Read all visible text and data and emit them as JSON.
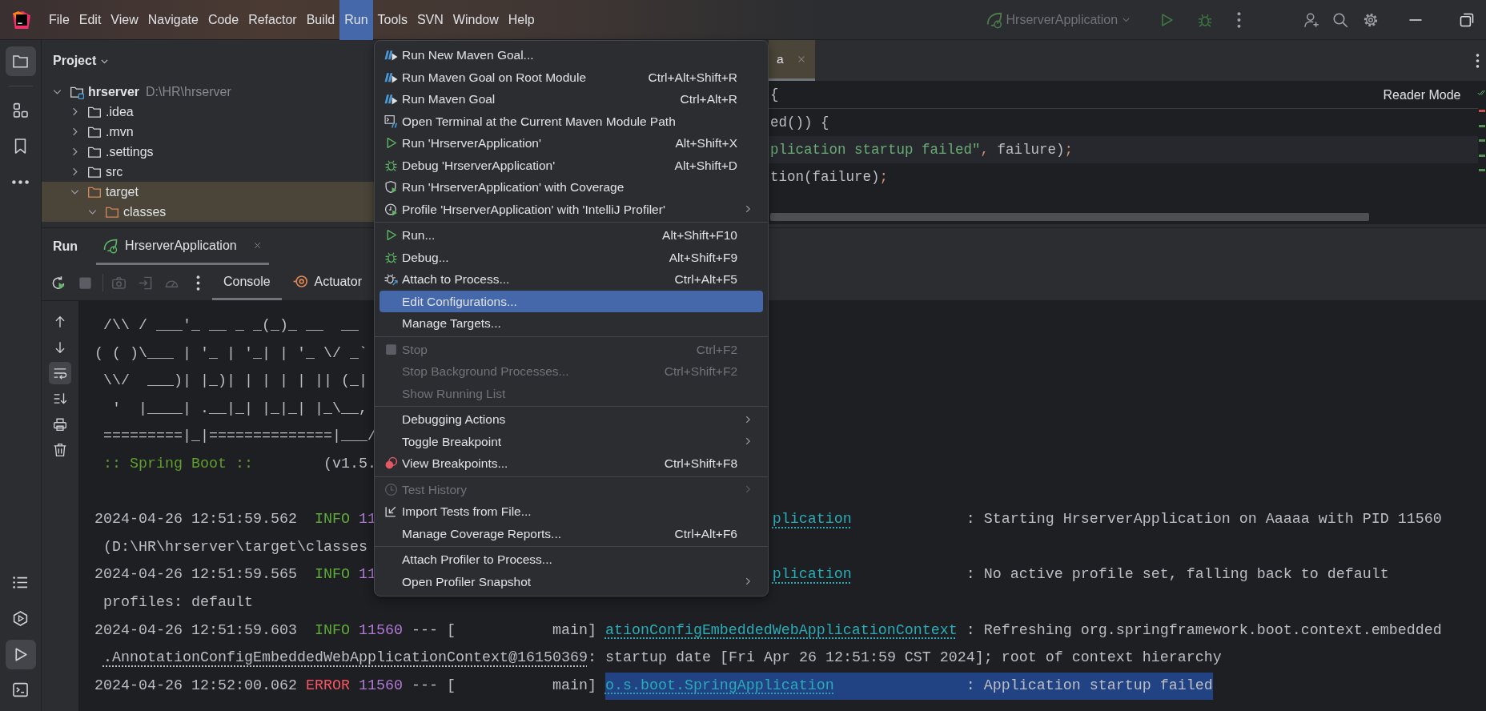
{
  "title_bar": {
    "menus": [
      {
        "label": "File",
        "selected": false
      },
      {
        "label": "Edit",
        "selected": false
      },
      {
        "label": "View",
        "selected": false
      },
      {
        "label": "Navigate",
        "selected": false
      },
      {
        "label": "Code",
        "selected": false
      },
      {
        "label": "Refactor",
        "selected": false
      },
      {
        "label": "Build",
        "selected": false
      },
      {
        "label": "Run",
        "selected": true
      },
      {
        "label": "Tools",
        "selected": false
      },
      {
        "label": "SVN",
        "selected": false
      },
      {
        "label": "Window",
        "selected": false
      },
      {
        "label": "Help",
        "selected": false
      }
    ],
    "run_config": "HrserverApplication"
  },
  "tool_strip": {
    "top": [
      {
        "kind": "project",
        "selected": true
      },
      {
        "kind": "structure",
        "selected": false
      },
      {
        "kind": "bookmarks",
        "selected": false
      },
      {
        "kind": "more",
        "selected": false
      }
    ],
    "bottom": [
      {
        "kind": "list",
        "selected": false
      },
      {
        "kind": "services",
        "selected": false
      },
      {
        "kind": "run",
        "selected": true
      },
      {
        "kind": "terminal",
        "selected": false
      }
    ]
  },
  "project": {
    "title": "Project",
    "tree": [
      {
        "name": "hrserver",
        "path": "D:\\HR\\hrserver",
        "module": true,
        "expanded": true,
        "excluded": false,
        "children": [
          {
            "name": ".idea",
            "expanded": false,
            "excluded": false
          },
          {
            "name": ".mvn",
            "expanded": false,
            "excluded": false
          },
          {
            "name": ".settings",
            "expanded": false,
            "excluded": false
          },
          {
            "name": "src",
            "expanded": false,
            "excluded": false
          },
          {
            "name": "target",
            "expanded": true,
            "excluded": true,
            "children": [
              {
                "name": "classes",
                "expanded": true,
                "excluded": true
              }
            ]
          }
        ]
      }
    ]
  },
  "editor": {
    "tabs": [
      {
        "label": "a",
        "selected": true
      }
    ],
    "reader_mode": "Reader Mode",
    "sticky_line": [
      {
        "kind": "plain",
        "text": "{"
      }
    ],
    "lines": [
      {
        "highlighted": false,
        "segments": [
          {
            "kind": "plain",
            "text": "ed()) {"
          }
        ]
      },
      {
        "highlighted": true,
        "segments": [
          {
            "kind": "string",
            "text": "plication startup failed\""
          },
          {
            "kind": "keyword",
            "text": ","
          },
          {
            "kind": "plain",
            "text": " failure)"
          },
          {
            "kind": "keyword",
            "text": ";"
          }
        ]
      },
      {
        "highlighted": false,
        "segments": [
          {
            "kind": "plain",
            "text": "tion(failure)"
          },
          {
            "kind": "keyword",
            "text": ";"
          }
        ]
      }
    ],
    "change_marks": [
      {
        "color": "#c75450"
      },
      {
        "color": "#549159"
      },
      {
        "color": "#549159"
      },
      {
        "color": "#549159"
      },
      {
        "color": "#549159"
      }
    ]
  },
  "run_window": {
    "title": "Run",
    "tabs": [
      {
        "label": "HrserverApplication",
        "selected": true
      }
    ],
    "toolbar": [
      {
        "kind": "rerun",
        "disabled": false
      },
      {
        "kind": "stop",
        "disabled": true
      },
      {
        "kind": "screenshot",
        "disabled": true
      },
      {
        "kind": "exit",
        "disabled": true
      },
      {
        "kind": "gauge",
        "disabled": true
      },
      {
        "kind": "more",
        "disabled": false
      }
    ],
    "views": [
      {
        "label": "Console",
        "kind": "console",
        "selected": true
      },
      {
        "label": "Actuator",
        "kind": "actuator",
        "selected": false
      }
    ],
    "console_tools": [
      {
        "kind": "up",
        "selected": false
      },
      {
        "kind": "down",
        "selected": false
      },
      {
        "kind": "wrap",
        "selected": true
      },
      {
        "kind": "scroll-end",
        "selected": false
      },
      {
        "kind": "print",
        "selected": false
      },
      {
        "kind": "trash",
        "selected": false
      }
    ],
    "console": [
      {
        "kind": "banner",
        "highlighted": false,
        "segments": [
          {
            "kind": "plain",
            "text": " /\\\\ / ___'_ __ _ _(_)_ __  __"
          }
        ]
      },
      {
        "kind": "banner",
        "highlighted": false,
        "segments": [
          {
            "kind": "plain",
            "text": "( ( )\\___ | '_ | '_| | '_ \\/ _`"
          }
        ]
      },
      {
        "kind": "banner",
        "highlighted": false,
        "segments": [
          {
            "kind": "plain",
            "text": " \\\\/  ___)| |_)| | | | | || (_|"
          }
        ]
      },
      {
        "kind": "banner",
        "highlighted": false,
        "segments": [
          {
            "kind": "plain",
            "text": "  '  |____| .__|_| |_|_| |_\\__,"
          }
        ]
      },
      {
        "kind": "banner",
        "highlighted": false,
        "segments": [
          {
            "kind": "plain",
            "text": " =========|_|==============|___/"
          }
        ]
      },
      {
        "kind": "banner",
        "highlighted": false,
        "segments": [
          {
            "kind": "green",
            "text": " :: Spring Boot ::"
          },
          {
            "kind": "plain",
            "text": "        (v1.5."
          }
        ]
      },
      {
        "kind": "blank",
        "highlighted": false
      },
      {
        "kind": "log",
        "highlighted": false,
        "segments": [
          {
            "kind": "time",
            "text": "2024-04-26 12:51:59.562"
          },
          {
            "kind": "info",
            "text": "INFO"
          },
          {
            "kind": "pid",
            "text": "11"
          }
        ],
        "right": [
          {
            "kind": "logger",
            "text": "plication"
          },
          {
            "kind": "plain",
            "text": ": Starting HrserverApplication on Aaaaa with PID 11560"
          }
        ]
      },
      {
        "kind": "wrap",
        "highlighted": false,
        "segments": [
          {
            "kind": "plain",
            "text": "(D:\\HR\\hrserver\\target\\classes"
          }
        ]
      },
      {
        "kind": "log",
        "highlighted": false,
        "segments": [
          {
            "kind": "time",
            "text": "2024-04-26 12:51:59.565"
          },
          {
            "kind": "info",
            "text": "INFO"
          },
          {
            "kind": "pid",
            "text": "11"
          }
        ],
        "right": [
          {
            "kind": "logger",
            "text": "plication"
          },
          {
            "kind": "plain",
            "text": ": No active profile set, falling back to default"
          }
        ]
      },
      {
        "kind": "wrap",
        "highlighted": false,
        "segments": [
          {
            "kind": "plain",
            "text": "profiles: default"
          }
        ]
      },
      {
        "kind": "log",
        "highlighted": false,
        "segments": [
          {
            "kind": "time",
            "text": "2024-04-26 12:51:59.603"
          },
          {
            "kind": "info",
            "text": "INFO"
          },
          {
            "kind": "pid",
            "text": "11560"
          },
          {
            "kind": "thread",
            "text": "--- [           main]"
          },
          {
            "kind": "logger",
            "text": "ationConfigEmbeddedWebApplicationContext"
          },
          {
            "kind": "plain",
            "text": ": Refreshing org.springframework.boot.context.embedded"
          }
        ]
      },
      {
        "kind": "wrap",
        "highlighted": false,
        "segments": [
          {
            "kind": "link",
            "text": ".AnnotationConfigEmbeddedWebApplicationContext@16150369"
          },
          {
            "kind": "plain",
            "text": ": startup date [Fri Apr 26 12:51:59 CST 2024]; root of context hierarchy"
          }
        ]
      },
      {
        "kind": "log",
        "highlighted": true,
        "segments": [
          {
            "kind": "time",
            "text": "2024-04-26 12:52:00.062"
          },
          {
            "kind": "error",
            "text": "ERROR"
          },
          {
            "kind": "pid",
            "text": "11560"
          },
          {
            "kind": "thread",
            "text": "--- [           main]"
          },
          {
            "kind": "logger",
            "text": "o.s.boot.SpringApplication"
          },
          {
            "kind": "plain",
            "text": ": Application startup failed"
          }
        ]
      }
    ]
  },
  "run_menu": {
    "groups": [
      {
        "items": [
          {
            "kind": "maven",
            "label": "Run New Maven Goal...",
            "selected": false,
            "disabled": false,
            "submenu": false
          },
          {
            "kind": "maven",
            "label": "Run Maven Goal on Root Module",
            "shortcut": "Ctrl+Alt+Shift+R",
            "selected": false,
            "disabled": false,
            "submenu": false
          },
          {
            "kind": "maven",
            "label": "Run Maven Goal",
            "shortcut": "Ctrl+Alt+R",
            "selected": false,
            "disabled": false,
            "submenu": false
          },
          {
            "kind": "terminal",
            "label": "Open Terminal at the Current Maven Module Path",
            "selected": false,
            "disabled": false,
            "submenu": false
          },
          {
            "kind": "run",
            "label": "Run 'HrserverApplication'",
            "shortcut": "Alt+Shift+X",
            "selected": false,
            "disabled": false,
            "submenu": false
          },
          {
            "kind": "debug",
            "label": "Debug 'HrserverApplication'",
            "shortcut": "Alt+Shift+D",
            "selected": false,
            "disabled": false,
            "submenu": false
          },
          {
            "kind": "coverage",
            "label": "Run 'HrserverApplication' with Coverage",
            "selected": false,
            "disabled": false,
            "submenu": false
          },
          {
            "kind": "profiler",
            "label": "Profile 'HrserverApplication' with 'IntelliJ Profiler'",
            "selected": false,
            "disabled": false,
            "submenu": true
          }
        ]
      },
      {
        "items": [
          {
            "kind": "run",
            "label": "Run...",
            "shortcut": "Alt+Shift+F10",
            "selected": false,
            "disabled": false,
            "submenu": false
          },
          {
            "kind": "debug",
            "label": "Debug...",
            "shortcut": "Alt+Shift+F9",
            "selected": false,
            "disabled": false,
            "submenu": false
          },
          {
            "kind": "attach",
            "label": "Attach to Process...",
            "shortcut": "Ctrl+Alt+F5",
            "selected": false,
            "disabled": false,
            "submenu": false
          },
          {
            "kind": "plain",
            "label": "Edit Configurations...",
            "selected": true,
            "disabled": false,
            "submenu": false
          },
          {
            "kind": "plain",
            "label": "Manage Targets...",
            "selected": false,
            "disabled": false,
            "submenu": false
          }
        ]
      },
      {
        "items": [
          {
            "kind": "stop",
            "label": "Stop",
            "shortcut": "Ctrl+F2",
            "selected": false,
            "disabled": true,
            "submenu": false
          },
          {
            "kind": "plain",
            "label": "Stop Background Processes...",
            "shortcut": "Ctrl+Shift+F2",
            "selected": false,
            "disabled": true,
            "submenu": false
          },
          {
            "kind": "plain",
            "label": "Show Running List",
            "selected": false,
            "disabled": true,
            "submenu": false
          }
        ]
      },
      {
        "items": [
          {
            "kind": "plain",
            "label": "Debugging Actions",
            "selected": false,
            "disabled": false,
            "submenu": true
          },
          {
            "kind": "plain",
            "label": "Toggle Breakpoint",
            "selected": false,
            "disabled": false,
            "submenu": true
          },
          {
            "kind": "breakpoints",
            "label": "View Breakpoints...",
            "shortcut": "Ctrl+Shift+F8",
            "selected": false,
            "disabled": false,
            "submenu": false
          }
        ]
      },
      {
        "items": [
          {
            "kind": "history",
            "label": "Test History",
            "selected": false,
            "disabled": true,
            "submenu": true
          },
          {
            "kind": "import",
            "label": "Import Tests from File...",
            "selected": false,
            "disabled": false,
            "submenu": false
          },
          {
            "kind": "plain",
            "label": "Manage Coverage Reports...",
            "shortcut": "Ctrl+Alt+F6",
            "selected": false,
            "disabled": false,
            "submenu": false
          }
        ]
      },
      {
        "items": [
          {
            "kind": "plain",
            "label": "Attach Profiler to Process...",
            "selected": false,
            "disabled": false,
            "submenu": false
          },
          {
            "kind": "plain",
            "label": "Open Profiler Snapshot",
            "selected": false,
            "disabled": false,
            "submenu": true
          }
        ]
      }
    ]
  }
}
